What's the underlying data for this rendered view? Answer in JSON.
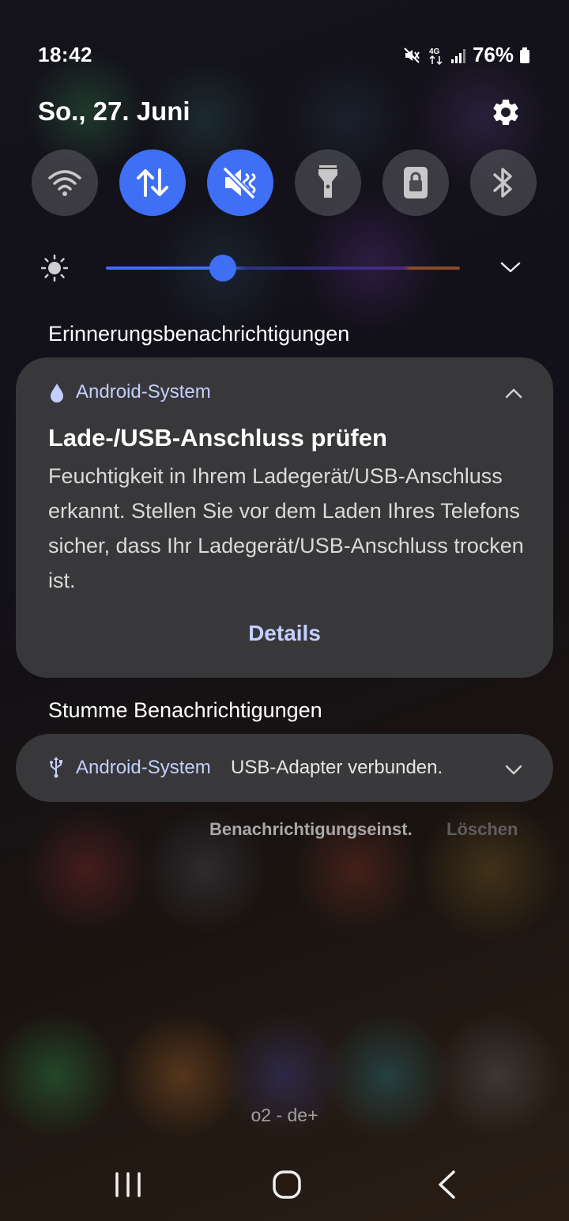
{
  "status_bar": {
    "time": "18:42",
    "network": "4G",
    "battery": "76%",
    "icons": [
      "mute-icon",
      "data-4g-icon",
      "signal-icon",
      "battery-icon"
    ]
  },
  "header": {
    "date": "So., 27. Juni",
    "settings_icon": "gear-icon"
  },
  "quick_settings": {
    "tiles": [
      {
        "name": "wifi",
        "icon": "wifi-icon",
        "active": false
      },
      {
        "name": "mobile-data",
        "icon": "mobile-data-icon",
        "active": true
      },
      {
        "name": "mute",
        "icon": "mute-icon",
        "active": true
      },
      {
        "name": "flashlight",
        "icon": "flashlight-icon",
        "active": false
      },
      {
        "name": "screen-lock",
        "icon": "lock-icon",
        "active": false
      },
      {
        "name": "bluetooth",
        "icon": "bluetooth-icon",
        "active": false
      }
    ],
    "brightness": {
      "level": 0.33,
      "icon": "sun-icon"
    },
    "accent_color": "#3e6ff5"
  },
  "sections": {
    "reminders_title": "Erinnerungsbenachrichtigungen",
    "silent_title": "Stumme Benachrichtigungen"
  },
  "notification_1": {
    "app": "Android-System",
    "app_icon": "water-drop-icon",
    "title": "Lade-/USB-Anschluss prüfen",
    "body": "Feuchtigkeit in Ihrem Ladegerät/USB-Anschluss erkannt. Stellen Sie vor dem Laden Ihres Telefons sicher, dass Ihr Ladegerät/USB-Anschluss trocken ist.",
    "action": "Details"
  },
  "notification_2": {
    "app": "Android-System",
    "app_icon": "usb-icon",
    "message": "USB-Adapter verbunden."
  },
  "footer_actions": {
    "settings": "Benachrichtigungseinst.",
    "clear": "Löschen"
  },
  "carrier": "o2 - de+",
  "navigation": {
    "recents_icon": "recents-icon",
    "home_icon": "home-icon",
    "back_icon": "back-icon"
  }
}
